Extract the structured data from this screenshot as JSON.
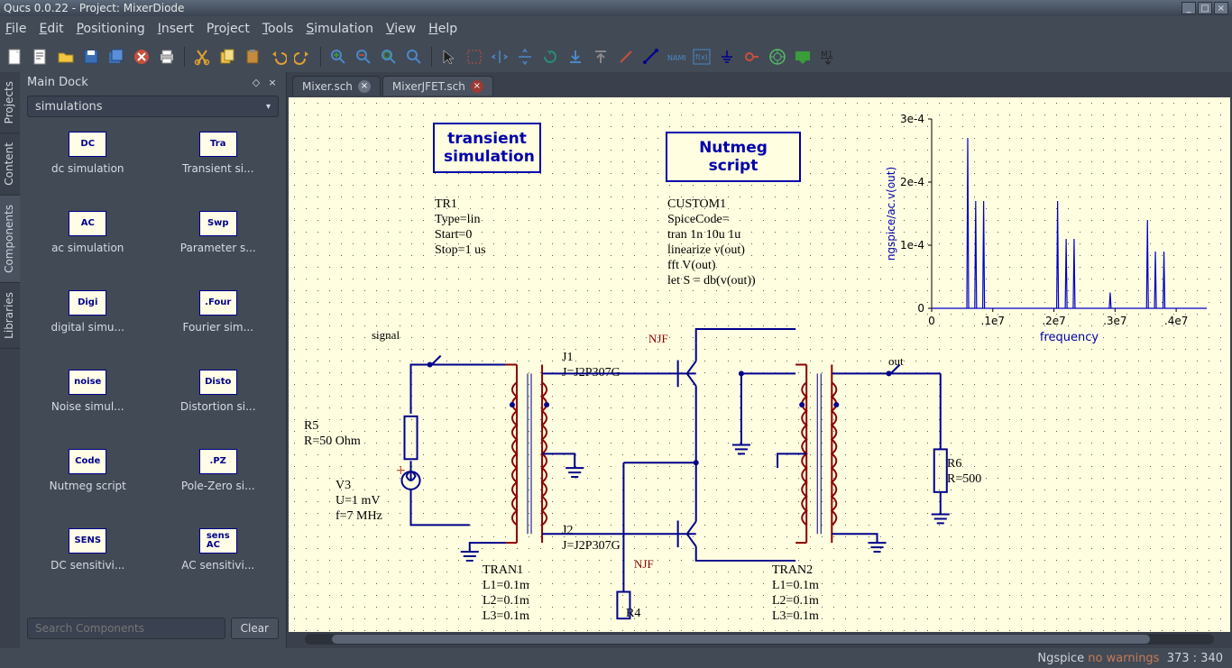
{
  "window": {
    "title": "Qucs 0.0.22 - Project: MixerDiode"
  },
  "menu": {
    "file": "File",
    "edit": "Edit",
    "positioning": "Positioning",
    "insert": "Insert",
    "project": "Project",
    "tools": "Tools",
    "simulation": "Simulation",
    "view": "View",
    "help": "Help"
  },
  "dock": {
    "title": "Main Dock",
    "category": "simulations",
    "search_placeholder": "Search Components",
    "clear": "Clear",
    "items": [
      {
        "icon": "DC",
        "label": "dc simulation"
      },
      {
        "icon": "Tra",
        "label": "Transient si..."
      },
      {
        "icon": "AC",
        "label": "ac simulation"
      },
      {
        "icon": "Swp",
        "label": "Parameter s..."
      },
      {
        "icon": "Digi",
        "label": "digital simu..."
      },
      {
        "icon": ".Four",
        "label": "Fourier sim..."
      },
      {
        "icon": "noise",
        "label": "Noise simul..."
      },
      {
        "icon": "Disto",
        "label": "Distortion si..."
      },
      {
        "icon": "Code",
        "label": "Nutmeg script"
      },
      {
        "icon": ".PZ",
        "label": "Pole-Zero si..."
      },
      {
        "icon": "SENS",
        "label": "DC sensitivi..."
      },
      {
        "icon": "sens\nAC",
        "label": "AC sensitivi..."
      }
    ]
  },
  "sidetabs": {
    "projects": "Projects",
    "content": "Content",
    "components": "Components",
    "libraries": "Libraries"
  },
  "tabs": {
    "t1": "Mixer.sch",
    "t2": "MixerJFET.sch"
  },
  "sim": {
    "tran_title": "transient\nsimulation",
    "tran_body": "TR1\nType=lin\nStart=0\nStop=1 us",
    "nut_title": "Nutmeg script",
    "nut_body": "CUSTOM1\nSpiceCode=\ntran 1n 10u 1u\nlinearize v(out)\nfft V(out)\nlet S = db(v(out))"
  },
  "labels": {
    "signal": "signal",
    "njf1": "NJF",
    "njf2": "NJF",
    "out": "out",
    "j1": "J1\nJ=J2P307G",
    "j2": "J2\nJ=J2P307G",
    "r5": "R5\nR=50 Ohm",
    "v3": "V3\nU=1 mV\nf=7 MHz",
    "r6": "R6\nR=500",
    "r4": "R4",
    "tran1": "TRAN1\nL1=0.1m\nL2=0.1m\nL3=0.1m",
    "tran2": "TRAN2\nL1=0.1m\nL2=0.1m\nL3=0.1m"
  },
  "chart_data": {
    "type": "line",
    "title": "",
    "xlabel": "frequency",
    "ylabel": "ngspice/ac.v(out)",
    "xlim": [
      0,
      45000000.0
    ],
    "ylim": [
      0,
      0.0003
    ],
    "xticks": [
      0,
      10000000.0,
      20000000.0,
      30000000.0,
      40000000.0
    ],
    "xtick_labels": [
      "0",
      ".1e7",
      ".2e7",
      ".3e7",
      ".4e7"
    ],
    "yticks": [
      0,
      0.0001,
      0.0002,
      0.0003
    ],
    "ytick_labels": [
      "0",
      "1e-4",
      "2e-4",
      "3e-4"
    ],
    "peaks": [
      {
        "x": 5900000.0,
        "y": 0.00027
      },
      {
        "x": 7200000.0,
        "y": 0.00017
      },
      {
        "x": 8500000.0,
        "y": 0.00017
      },
      {
        "x": 20600000.0,
        "y": 0.00017
      },
      {
        "x": 22000000.0,
        "y": 0.00011
      },
      {
        "x": 23300000.0,
        "y": 0.00011
      },
      {
        "x": 29200000.0,
        "y": 2.5e-05
      },
      {
        "x": 35300000.0,
        "y": 0.00014
      },
      {
        "x": 36600000.0,
        "y": 9e-05
      },
      {
        "x": 38000000.0,
        "y": 9e-05
      }
    ]
  },
  "status": {
    "engine": "Ngspice",
    "warn": "no warnings",
    "coords": "373 : 340"
  }
}
